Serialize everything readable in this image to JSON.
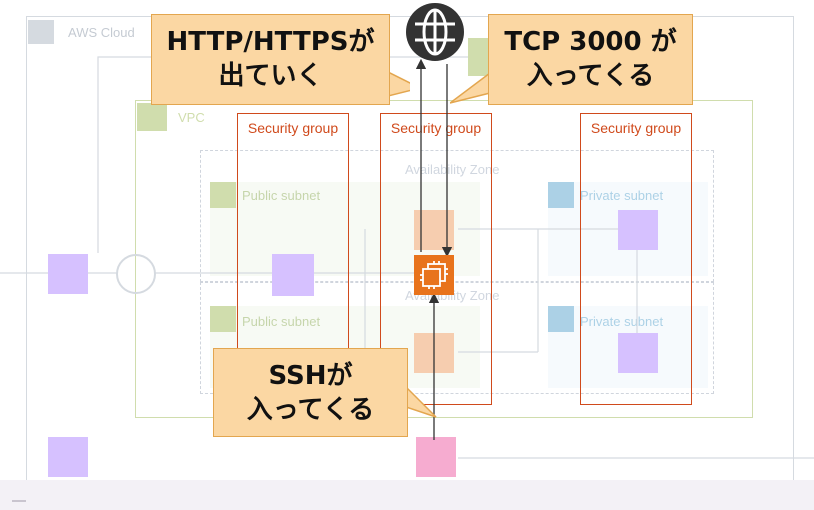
{
  "diagram": {
    "cloud_label": "AWS Cloud",
    "vpc_label": "VPC",
    "az_labels": [
      "Availability Zone",
      "Availability Zone"
    ],
    "public_subnet_labels": [
      "Public subnet",
      "Public subnet"
    ],
    "private_subnet_labels": [
      "Private subnet",
      "Private subnet"
    ],
    "security_groups": [
      "Security group",
      "Security group",
      "Security group"
    ]
  },
  "callouts": {
    "http": [
      "HTTP/HTTPSが",
      "出ていく"
    ],
    "tcp": [
      "TCP 3000 が",
      "入ってくる"
    ],
    "ssh": [
      "SSHが",
      "入ってくる"
    ]
  },
  "icons": {
    "internet": "globe-icon",
    "ec2": "ec2-instance-icon"
  },
  "colors": {
    "security_group": "#d04a1c",
    "callout_fill": "#fbd7a3",
    "callout_border": "#e3a64f",
    "ec2": "#e8731c"
  }
}
